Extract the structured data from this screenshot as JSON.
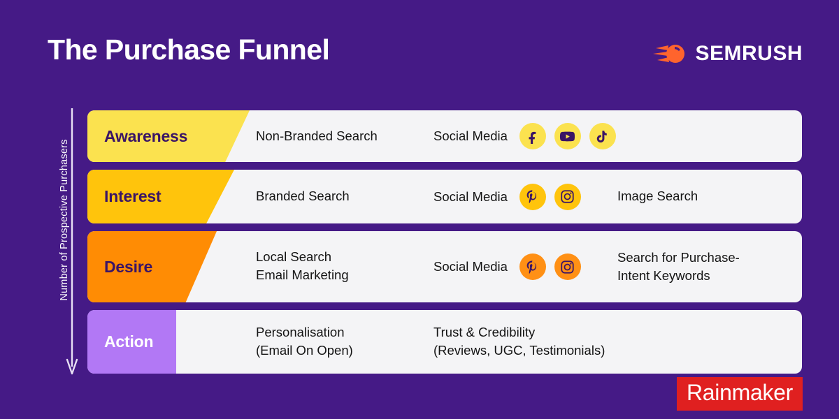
{
  "header": {
    "title": "The Purchase Funnel",
    "brand": {
      "name": "SEMRUSH",
      "mark": "semrush-comet-icon",
      "mark_color": "#ff642d"
    }
  },
  "axis": {
    "label": "Number of Prospective Purchasers",
    "direction": "down",
    "arrow_color": "#e8e0f4"
  },
  "colors": {
    "background": "#451a86",
    "card": "#f4f4f6",
    "stage_awareness": "#fbe24f",
    "stage_interest": "#ffc40c",
    "stage_desire": "#ff8c04",
    "stage_action": "#b278f5",
    "stage_text_dark": "#3a1466",
    "stage_text_light": "#ffffff",
    "body_text": "#141414",
    "rainmaker_red": "#e02020"
  },
  "funnel": {
    "rows": [
      {
        "stage": "Awareness",
        "tasks": "Non-Branded Search",
        "social_label": "Social Media",
        "social_icons": [
          "facebook-icon",
          "youtube-icon",
          "tiktok-icon"
        ],
        "extra": ""
      },
      {
        "stage": "Interest",
        "tasks": "Branded Search",
        "social_label": "Social Media",
        "social_icons": [
          "pinterest-icon",
          "instagram-icon"
        ],
        "extra": "Image Search"
      },
      {
        "stage": "Desire",
        "tasks": "Local Search\nEmail Marketing",
        "social_label": "Social Media",
        "social_icons": [
          "pinterest-icon",
          "instagram-icon"
        ],
        "extra": "Search for Purchase-\nIntent Keywords"
      },
      {
        "stage": "Action",
        "tasks": "Personalisation\n(Email On Open)",
        "social_label": "Trust & Credibility\n(Reviews, UGC, Testimonials)",
        "social_icons": [],
        "extra": ""
      }
    ]
  },
  "footer": {
    "rainmaker": "Rainmaker"
  }
}
